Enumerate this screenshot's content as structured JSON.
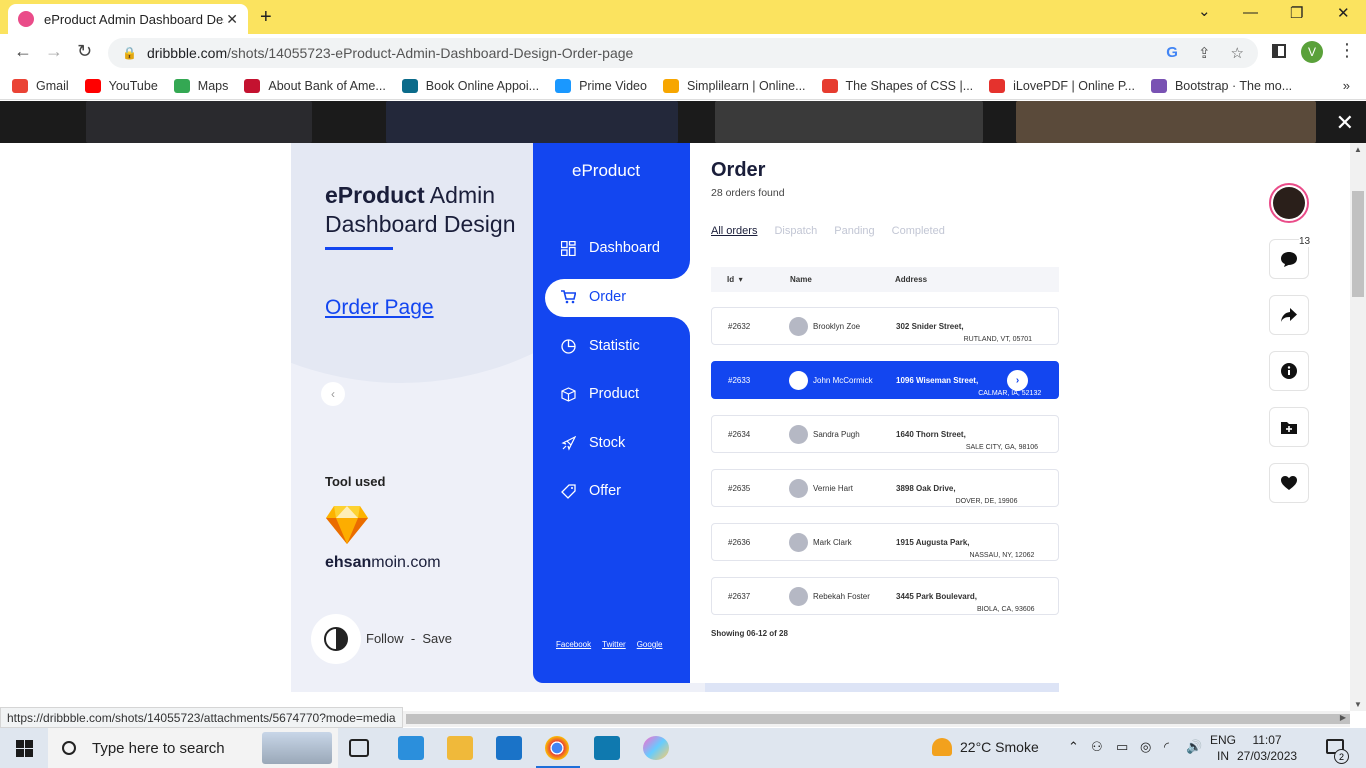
{
  "browser": {
    "tab_title": "eProduct Admin Dashboard Design - Order page",
    "tab_close": "✕",
    "new_tab": "+",
    "url_domain": "dribbble.com",
    "url_path": "/shots/14055723-eProduct-Admin-Dashboard-Design-Order-page",
    "profile_initial": "V",
    "win_min": "—",
    "win_restore": "❐",
    "win_close": "✕",
    "tab_dropdown": "⌄"
  },
  "bookmarks": [
    {
      "label": "Gmail",
      "color": "#ea4335"
    },
    {
      "label": "YouTube",
      "color": "#ff0000"
    },
    {
      "label": "Maps",
      "color": "#34a853"
    },
    {
      "label": "About Bank of Ame...",
      "color": "#c41230"
    },
    {
      "label": "Book Online Appoi...",
      "color": "#0b6b8a"
    },
    {
      "label": "Prime Video",
      "color": "#1a98ff"
    },
    {
      "label": "Simplilearn | Online...",
      "color": "#f7a600"
    },
    {
      "label": "The Shapes of CSS |...",
      "color": "#e63c2f"
    },
    {
      "label": "iLovePDF | Online P...",
      "color": "#e5322d"
    },
    {
      "label": "Bootstrap · The mo...",
      "color": "#7952b3"
    }
  ],
  "bookmarks_more": "»",
  "overlay_close": "✕",
  "shot": {
    "title_bold": "eProduct",
    "title_rest": " Admin",
    "title_line2": "Dashboard Design",
    "page_link": "Order Page",
    "prev": "‹",
    "tool_used": "Tool used",
    "brand_bold": "ehsan",
    "brand_rest": "moin.com",
    "follow": "Follow",
    "separator": "-",
    "save": "Save"
  },
  "dashboard": {
    "logo": "eProduct",
    "nav": [
      {
        "label": "Dashboard",
        "icon": "grid-icon"
      },
      {
        "label": "Order",
        "icon": "cart-icon"
      },
      {
        "label": "Statistic",
        "icon": "pie-chart-icon"
      },
      {
        "label": "Product",
        "icon": "box-icon"
      },
      {
        "label": "Stock",
        "icon": "rocket-icon"
      },
      {
        "label": "Offer",
        "icon": "tag-icon"
      }
    ],
    "links": [
      "Facebook",
      "Twitter",
      "Google"
    ],
    "order_title": "Order",
    "order_count": "28 orders found",
    "tabs": [
      "All orders",
      "Dispatch",
      "Panding",
      "Completed"
    ],
    "columns": [
      "Id",
      "Name",
      "Address"
    ],
    "sort_marker": "▾",
    "rows": [
      {
        "id": "#2632",
        "name": "Brooklyn Zoe",
        "street": "302  Snider Street,",
        "city": "RUTLAND, VT, 05701"
      },
      {
        "id": "#2633",
        "name": "John McCormick",
        "street": "1096  Wiseman Street,",
        "city": "CALMAR, IA, 52132"
      },
      {
        "id": "#2634",
        "name": "Sandra Pugh",
        "street": "1640  Thorn Street,",
        "city": "SALE CITY, GA, 98106"
      },
      {
        "id": "#2635",
        "name": "Vernie Hart",
        "street": "3898  Oak Drive,",
        "city": "DOVER, DE, 19906"
      },
      {
        "id": "#2636",
        "name": "Mark Clark",
        "street": "1915  Augusta Park,",
        "city": "NASSAU, NY, 12062"
      },
      {
        "id": "#2637",
        "name": "Rebekah Foster",
        "street": "3445  Park Boulevard,",
        "city": "BIOLA, CA, 93606"
      }
    ],
    "row_arrow": "›",
    "showing": "Showing 06-12 of 28"
  },
  "rail": {
    "comment_count": "13"
  },
  "status_url": "https://dribbble.com/shots/14055723/attachments/5674770?mode=media",
  "taskbar": {
    "search_placeholder": "Type here to search",
    "weather": "22°C  Smoke",
    "lang_top": "ENG",
    "lang_bottom": "IN",
    "time": "11:07",
    "date": "27/03/2023",
    "notif_count": "2"
  }
}
